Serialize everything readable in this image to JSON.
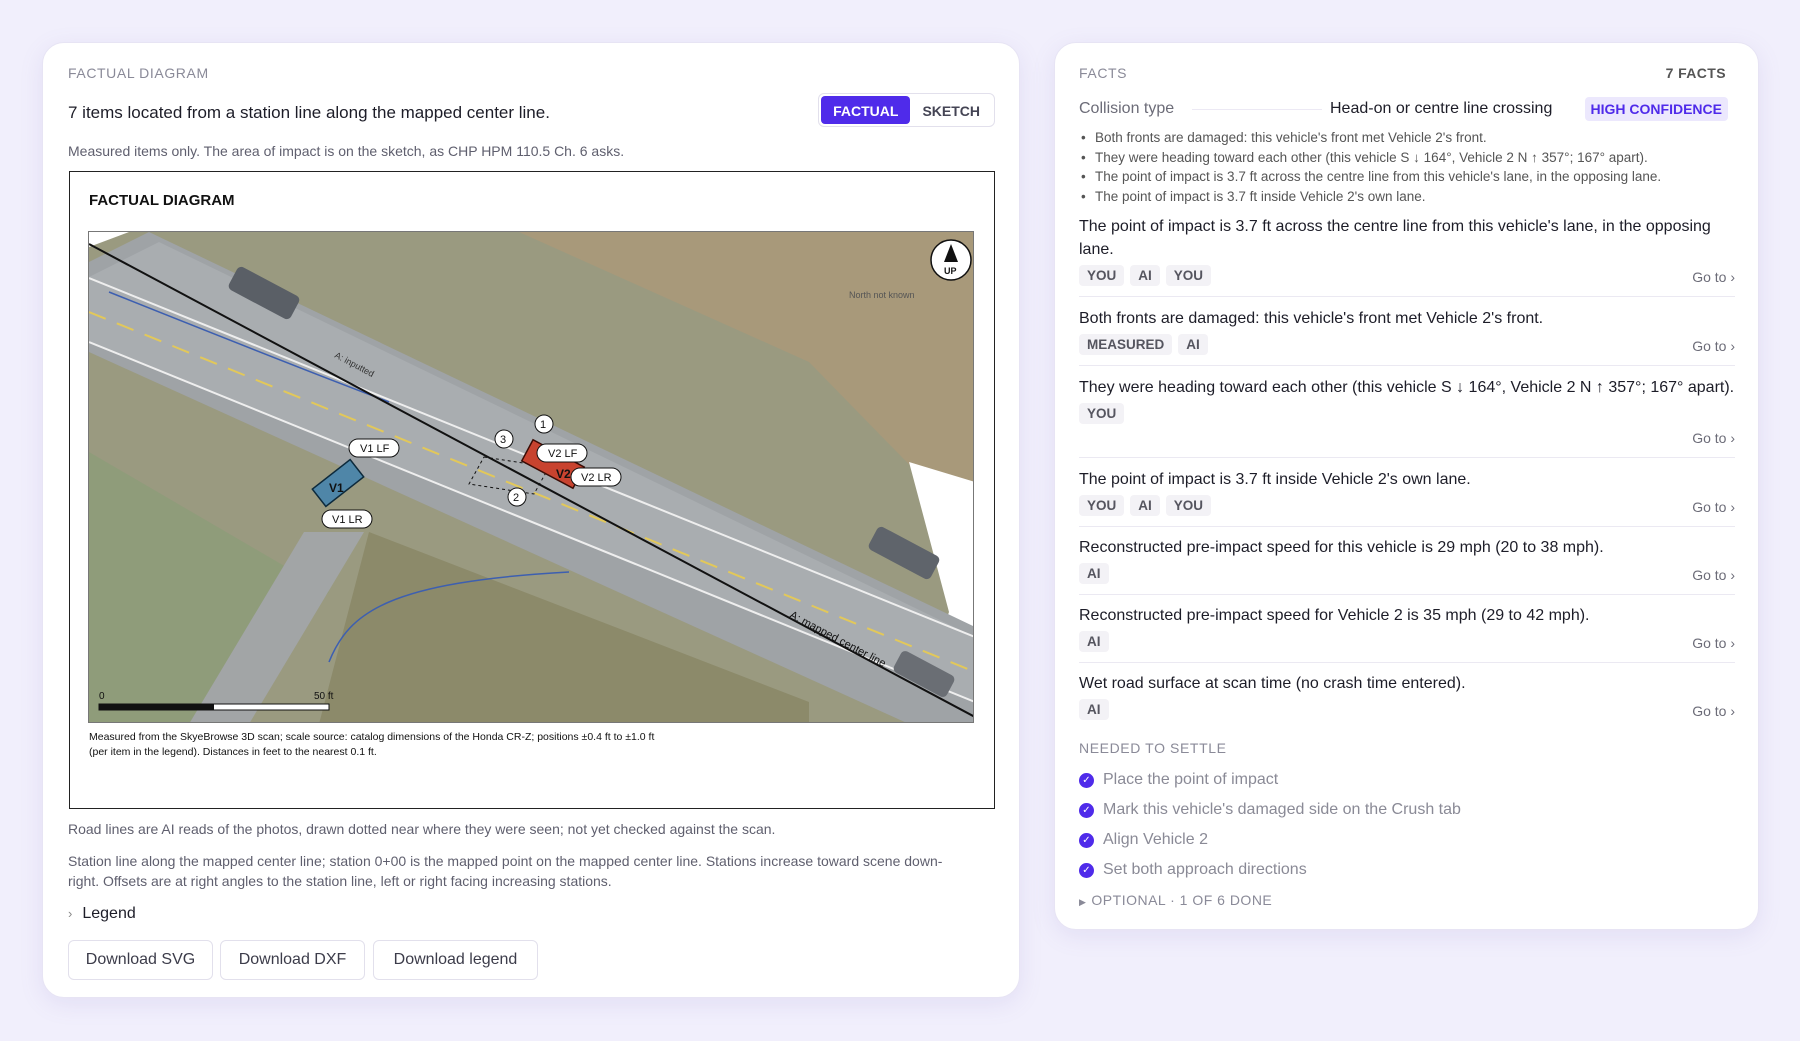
{
  "diagram_panel": {
    "eyebrow": "FACTUAL DIAGRAM",
    "title": "7 items located from a station line along the mapped center line.",
    "modes": {
      "factual": "FACTUAL",
      "sketch": "SKETCH",
      "active": "factual"
    },
    "subtitle": "Measured items only. The area of impact is on the sketch, as CHP HPM 110.5 Ch. 6 asks.",
    "diagram": {
      "heading": "FACTUAL DIAGRAM",
      "north": "UP",
      "north_note": "North not known",
      "centerline_label": "A: mapped center line",
      "inputs_label": "A: inputted",
      "vehicle_labels": {
        "v1": "V1",
        "v1_lf": "V1 LF",
        "v1_lr": "V1 LR",
        "v2": "V2",
        "v2_lf": "V2 LF",
        "v2_lr": "V2 LR"
      },
      "markers": [
        "1",
        "2",
        "3"
      ],
      "scale": {
        "start": "0",
        "end": "50 ft"
      },
      "caption_line1": "Measured from the SkyeBrowse 3D scan; scale source: catalog dimensions of the Honda CR-Z; positions ±0.4 ft to ±1.0 ft",
      "caption_line2": "(per item in the legend). Distances in feet to the nearest 0.1 ft."
    },
    "note_lines": "Road lines are AI reads of the photos, drawn dotted near where they were seen; not yet checked against the scan.",
    "note_station": "Station line along the mapped center line; station 0+00 is the mapped point on the mapped center line. Stations increase toward scene down-right. Offsets are at right angles to the station line, left or right facing increasing stations.",
    "legend_label": "Legend",
    "downloads": {
      "svg": "Download SVG",
      "dxf": "Download DXF",
      "legend": "Download legend"
    }
  },
  "facts_panel": {
    "eyebrow": "FACTS",
    "count": "7 FACTS",
    "collision_type_label": "Collision type",
    "collision_type_value": "Head-on or centre line crossing",
    "confidence": "HIGH CONFIDENCE",
    "summary": [
      "Both fronts are damaged: this vehicle's front met Vehicle 2's front.",
      "They were heading toward each other (this vehicle S ↓ 164°, Vehicle 2 N ↑ 357°; 167° apart).",
      "The point of impact is 3.7 ft across the centre line from this vehicle's lane, in the opposing lane.",
      "The point of impact is 3.7 ft inside Vehicle 2's own lane."
    ],
    "goto_label": "Go to ›",
    "facts": [
      {
        "text": "The point of impact is 3.7 ft across the centre line from this vehicle's lane, in the opposing lane.",
        "tags": [
          "YOU",
          "AI",
          "YOU"
        ]
      },
      {
        "text": "Both fronts are damaged: this vehicle's front met Vehicle 2's front.",
        "tags": [
          "MEASURED",
          "AI"
        ]
      },
      {
        "text": "They were heading toward each other (this vehicle S ↓ 164°, Vehicle 2 N ↑ 357°; 167° apart).",
        "tags": [
          "YOU"
        ]
      },
      {
        "text": "The point of impact is 3.7 ft inside Vehicle 2's own lane.",
        "tags": [
          "YOU",
          "AI",
          "YOU"
        ]
      },
      {
        "text": "Reconstructed pre-impact speed for this vehicle is 29 mph (20 to 38 mph).",
        "tags": [
          "AI"
        ]
      },
      {
        "text": "Reconstructed pre-impact speed for Vehicle 2 is 35 mph (29 to 42 mph).",
        "tags": [
          "AI"
        ]
      },
      {
        "text": "Wet road surface at scan time (no crash time entered).",
        "tags": [
          "AI"
        ]
      }
    ],
    "settle_eyebrow": "NEEDED TO SETTLE",
    "settle_items": [
      "Place the point of impact",
      "Mark this vehicle's damaged side on the Crush tab",
      "Align Vehicle 2",
      "Set both approach directions"
    ],
    "optional_label": "OPTIONAL · 1 OF 6 DONE"
  },
  "colors": {
    "accent": "#4f2bea",
    "background": "#f1effc",
    "vehicle_1": "#4f86a8",
    "vehicle_2": "#c8432f"
  }
}
